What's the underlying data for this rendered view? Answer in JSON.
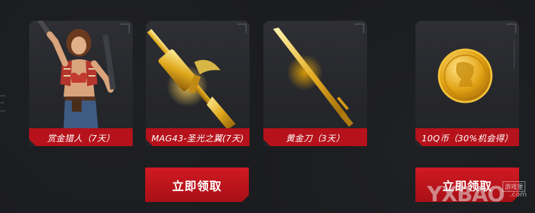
{
  "rewards": [
    {
      "label": "赏金猎人（7天）",
      "icon": "bounty-hunter-character"
    },
    {
      "label": "MAG43-圣光之翼(7天)",
      "icon": "golden-rifle"
    },
    {
      "label": "黄金刀（3天）",
      "icon": "golden-blade"
    },
    {
      "label": "10Q币（30%机会得）",
      "icon": "gold-coin"
    }
  ],
  "buttons": {
    "claim_left": "立即领取",
    "claim_right": "立即领取"
  },
  "watermark": {
    "brand": "YXBAO",
    "tag": "游戏堡",
    "url": ".com"
  },
  "colors": {
    "accent_red": "#b5121b",
    "gold": "#e0a81c",
    "background": "#1b1c1f"
  }
}
